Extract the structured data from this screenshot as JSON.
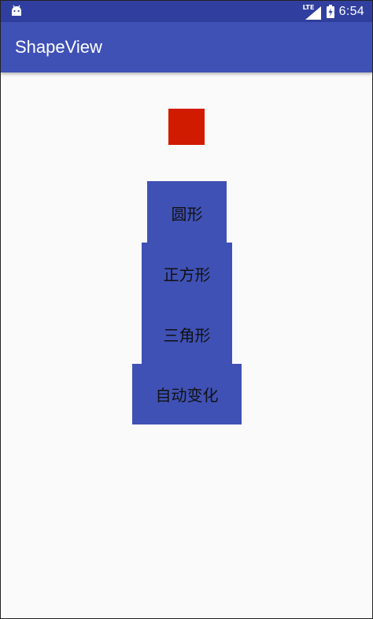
{
  "status_bar": {
    "network_label": "LTE",
    "time": "6:54",
    "icons": [
      "android-icon",
      "signal-icon",
      "battery-charging-icon"
    ]
  },
  "app_bar": {
    "title": "ShapeView"
  },
  "shape_view": {
    "color": "#d11b00"
  },
  "buttons": [
    {
      "label": "圆形"
    },
    {
      "label": "正方形"
    },
    {
      "label": "三角形"
    },
    {
      "label": "自动变化"
    }
  ],
  "colors": {
    "status_bar": "#303f9f",
    "primary": "#3f51b5",
    "background": "#fafafa"
  }
}
